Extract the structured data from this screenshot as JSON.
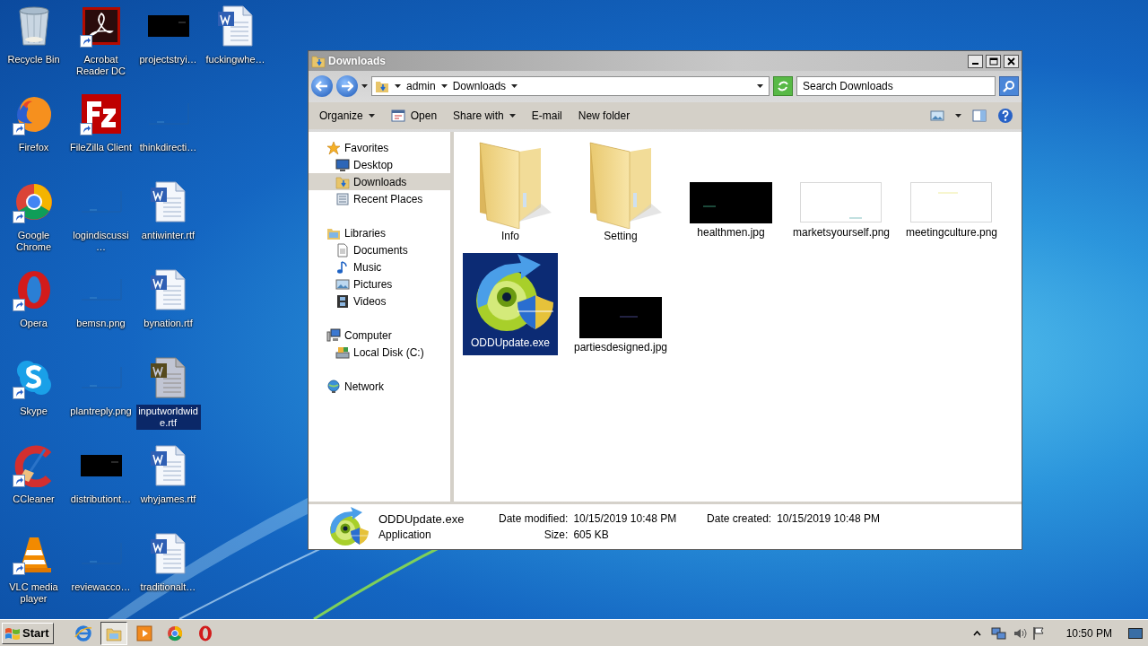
{
  "desktop": {
    "columns": [
      [
        {
          "label": "Recycle Bin",
          "kind": "trash",
          "shortcut": false,
          "selected": false
        },
        {
          "label": "Firefox",
          "kind": "app",
          "shortcut": true,
          "selected": false
        },
        {
          "label": "Google Chrome",
          "kind": "app",
          "shortcut": true,
          "selected": false
        },
        {
          "label": "Opera",
          "kind": "app",
          "shortcut": true,
          "selected": false
        },
        {
          "label": "Skype",
          "kind": "app",
          "shortcut": true,
          "selected": false
        },
        {
          "label": "CCleaner",
          "kind": "app",
          "shortcut": true,
          "selected": false
        },
        {
          "label": "VLC media player",
          "kind": "app",
          "shortcut": true,
          "selected": false
        }
      ],
      [
        {
          "label": "Acrobat Reader DC",
          "kind": "app",
          "shortcut": true,
          "selected": false
        },
        {
          "label": "FileZilla Client",
          "kind": "app",
          "shortcut": true,
          "selected": false
        },
        {
          "label": "logindiscussi…",
          "kind": "image-blank",
          "shortcut": false,
          "selected": false
        },
        {
          "label": "bemsn.png",
          "kind": "image-blank",
          "shortcut": false,
          "selected": false
        },
        {
          "label": "plantreply.png",
          "kind": "image-blank",
          "shortcut": false,
          "selected": false
        },
        {
          "label": "distributiont…",
          "kind": "image-black",
          "shortcut": false,
          "selected": false
        },
        {
          "label": "reviewacco…",
          "kind": "image-blank",
          "shortcut": false,
          "selected": false
        }
      ],
      [
        {
          "label": "projectstryi…",
          "kind": "image-black",
          "shortcut": false,
          "selected": false
        },
        {
          "label": "thinkdirecti…",
          "kind": "image-blank",
          "shortcut": false,
          "selected": false
        },
        {
          "label": "antiwinter.rtf",
          "kind": "document",
          "shortcut": false,
          "selected": false
        },
        {
          "label": "bynation.rtf",
          "kind": "document",
          "shortcut": false,
          "selected": false
        },
        {
          "label": "inputworldwide.rtf",
          "kind": "document",
          "shortcut": false,
          "selected": true
        },
        {
          "label": "whyjames.rtf",
          "kind": "document",
          "shortcut": false,
          "selected": false
        },
        {
          "label": "traditionalt…",
          "kind": "document",
          "shortcut": false,
          "selected": false
        }
      ],
      [
        {
          "label": "fuckingwhe…",
          "kind": "document",
          "shortcut": false,
          "selected": false
        }
      ]
    ]
  },
  "explorer": {
    "title": "Downloads",
    "breadcrumb": [
      "admin",
      "Downloads"
    ],
    "search": {
      "placeholder": "Search Downloads"
    },
    "toolbar": [
      {
        "label": "Organize",
        "kind": "menu"
      },
      {
        "label": "Open",
        "kind": "icon"
      },
      {
        "label": "Share with",
        "kind": "menu"
      },
      {
        "label": "E-mail",
        "kind": "plain"
      },
      {
        "label": "New folder",
        "kind": "plain"
      }
    ],
    "sidebar": [
      {
        "label": "Favorites",
        "selected": false,
        "children": [
          {
            "label": "Desktop",
            "selected": false
          },
          {
            "label": "Downloads",
            "selected": true
          },
          {
            "label": "Recent Places",
            "selected": false
          }
        ]
      },
      {
        "label": "Libraries",
        "selected": false,
        "children": [
          {
            "label": "Documents",
            "selected": false
          },
          {
            "label": "Music",
            "selected": false
          },
          {
            "label": "Pictures",
            "selected": false
          },
          {
            "label": "Videos",
            "selected": false
          }
        ]
      },
      {
        "label": "Computer",
        "selected": false,
        "children": [
          {
            "label": "Local Disk (C:)",
            "selected": false
          }
        ]
      },
      {
        "label": "Network",
        "selected": false
      }
    ],
    "files": [
      {
        "name": "Info",
        "kind": "folder",
        "selected": false
      },
      {
        "name": "Setting",
        "kind": "folder",
        "selected": false
      },
      {
        "name": "healthmen.jpg",
        "kind": "image-black",
        "selected": false
      },
      {
        "name": "marketsyourself.png",
        "kind": "image-white",
        "selected": false
      },
      {
        "name": "meetingculture.png",
        "kind": "image-white",
        "selected": false
      },
      {
        "name": "ODDUpdate.exe",
        "kind": "app",
        "selected": true
      },
      {
        "name": "partiesdesigned.jpg",
        "kind": "image-black",
        "selected": false
      }
    ],
    "details": {
      "name": "ODDUpdate.exe",
      "type": "Application",
      "fields": [
        {
          "label": "Date modified:",
          "value": "10/15/2019 10:48 PM"
        },
        {
          "label": "Date created:",
          "value": "10/15/2019 10:48 PM"
        },
        {
          "label": "Size:",
          "value": "605 KB"
        }
      ]
    }
  },
  "taskbar": {
    "start": "Start",
    "pinned": [
      {
        "selected": false
      },
      {
        "selected": true
      },
      {
        "selected": false
      },
      {
        "selected": false
      },
      {
        "selected": false
      }
    ],
    "clock": "10:50 PM"
  }
}
